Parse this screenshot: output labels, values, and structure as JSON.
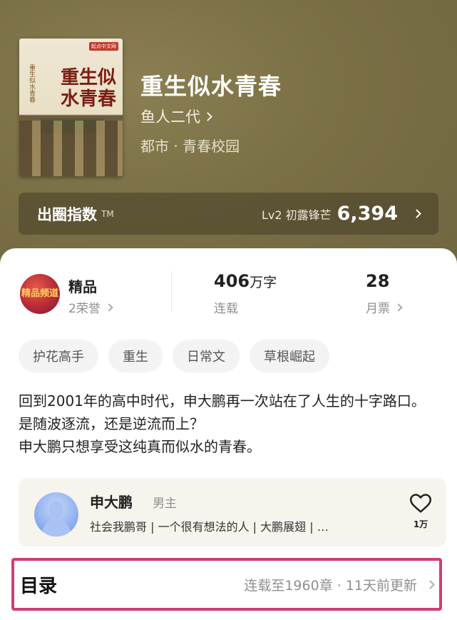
{
  "book": {
    "title": "重生似水青春",
    "author": "鱼人二代",
    "genre": "都市 · 青春校园",
    "cover": {
      "brand": "起点中文网",
      "title_art": "重生似水青春",
      "spine": "重生似水青春"
    }
  },
  "index_bar": {
    "label": "出圈指数",
    "tm": "TM",
    "level": "Lv2 初露锋芒",
    "score": "6,394"
  },
  "stats": {
    "badge_label": "精品",
    "badge_sub": "2荣誉",
    "badge_icon_text": "精品频道",
    "words_value": "406",
    "words_unit": "万字",
    "words_sub": "连载",
    "votes_value": "28",
    "votes_sub": "月票"
  },
  "tags": [
    "护花高手",
    "重生",
    "日常文",
    "草根崛起"
  ],
  "description": [
    "回到2001年的高中时代，申大鹏再一次站在了人生的十字路口。是随波逐流，还是逆流而上？",
    "申大鹏只想享受这纯真而似水的青春。"
  ],
  "character": {
    "name": "申大鹏",
    "role": "男主",
    "tags": "社会我鹏哥 | 一个很有想法的人 | 大鹏展翅 | …",
    "likes": "1万"
  },
  "toc": {
    "title": "目录",
    "meta": "连载至1960章 · 11天前更新"
  },
  "colors": {
    "hero_bg": "#7a6f45",
    "toc_highlight": "#d23c77"
  }
}
